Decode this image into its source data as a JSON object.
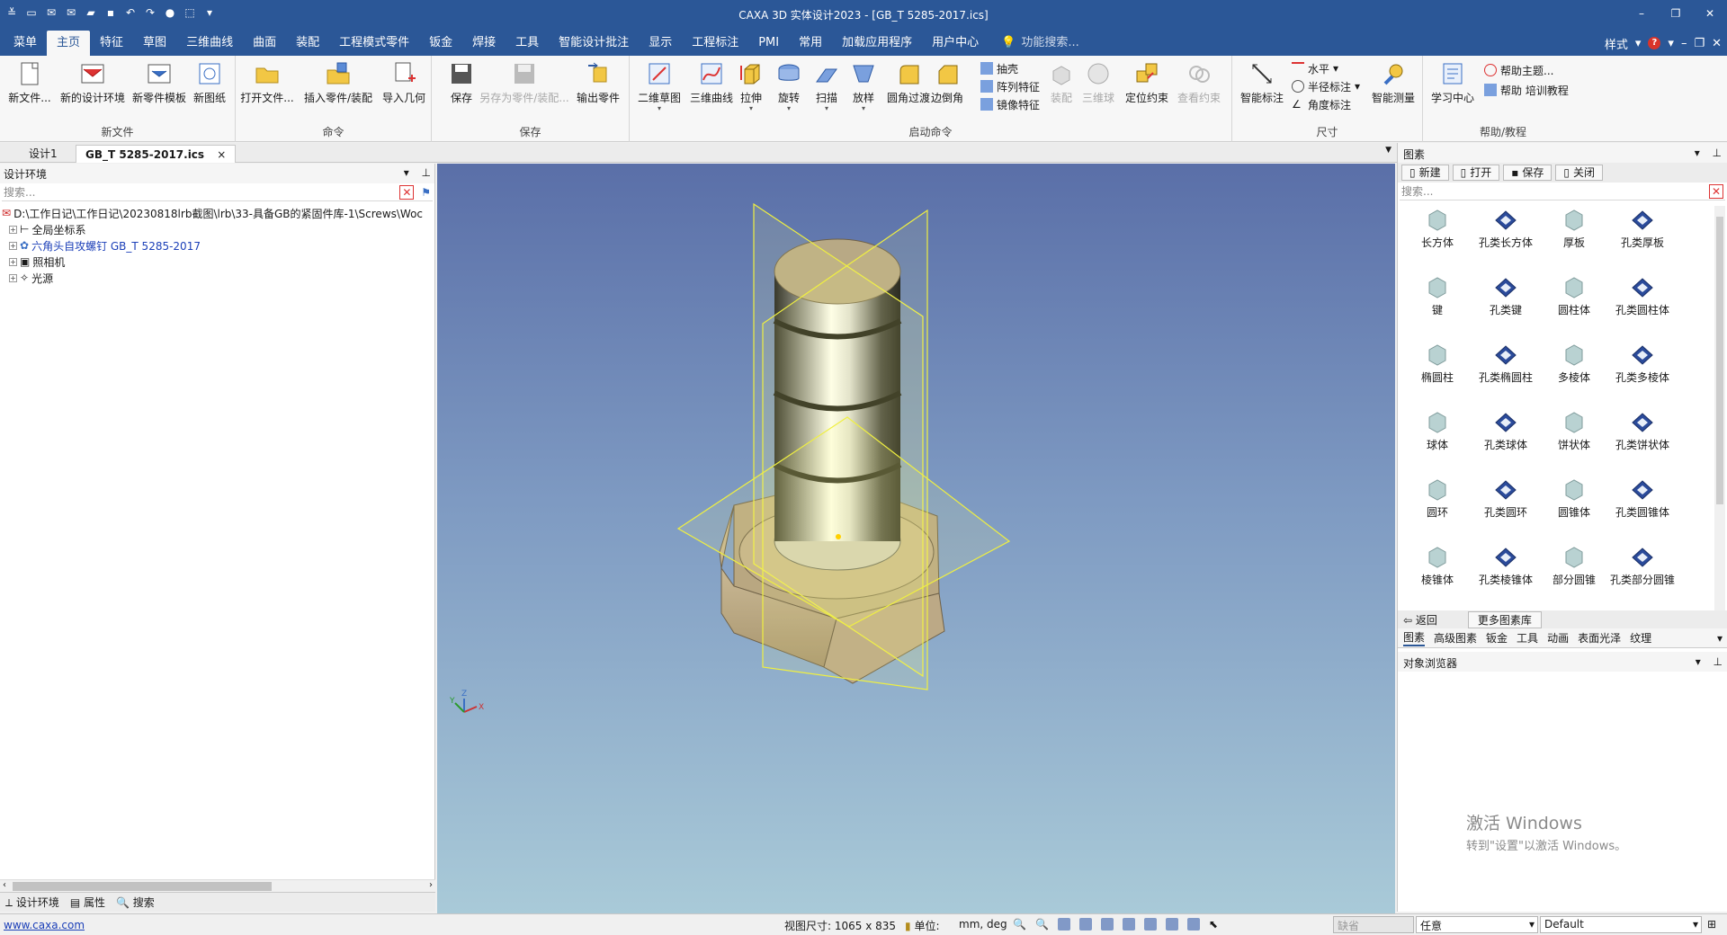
{
  "app": {
    "title": "CAXA 3D 实体设计2023 - [GB_T 5285-2017.ics]"
  },
  "menu": {
    "tabs": [
      "菜单",
      "主页",
      "特征",
      "草图",
      "三维曲线",
      "曲面",
      "装配",
      "工程模式零件",
      "钣金",
      "焊接",
      "工具",
      "智能设计批注",
      "显示",
      "工程标注",
      "PMI",
      "常用",
      "加载应用程序",
      "用户中心"
    ],
    "feature_search": "功能搜索...",
    "style_label": "样式",
    "help_icon_text": "?"
  },
  "ribbon": {
    "groups": {
      "new_file": "新文件",
      "command": "命令",
      "save": "保存",
      "launch": "启动命令",
      "dimension": "尺寸",
      "help": "帮助/教程"
    },
    "buttons": {
      "new_file": "新文件...",
      "new_env": "新的设计环境",
      "new_template": "新零件模板",
      "new_drawing": "新图纸",
      "open_file": "打开文件...",
      "insert_part": "插入零件/装配",
      "import_geom": "导入几何",
      "save": "保存",
      "save_as": "另存为零件/装配...",
      "export_part": "输出零件",
      "sketch2d": "二维草图",
      "curve3d": "三维曲线",
      "extrude": "拉伸",
      "revolve": "旋转",
      "sweep": "扫描",
      "loft": "放样",
      "fillet": "圆角过渡",
      "chamfer": "边倒角",
      "shell": "抽壳",
      "pattern": "阵列特征",
      "mirror": "镜像特征",
      "assemble": "装配",
      "ball3d": "三维球",
      "position_constraint": "定位约束",
      "view_constraint": "查看约束",
      "smart_dim": "智能标注",
      "horizontal": "水平",
      "radius_dim": "半径标注",
      "angle_dim": "角度标注",
      "smart_measure": "智能测量",
      "learning_center": "学习中心",
      "help_topics": "帮助主题...",
      "help_training": "帮助 培训教程"
    }
  },
  "doc_tabs": [
    "设计1",
    "GB_T 5285-2017.ics"
  ],
  "left_panel": {
    "title": "设计环境",
    "search_placeholder": "搜索...",
    "path": "D:\\工作日记\\工作日记\\20230818lrb截图\\lrb\\33-具备GB的紧固件库-1\\Screws\\Woc",
    "tree": [
      {
        "label": "全局坐标系",
        "link": false
      },
      {
        "label": "六角头自攻螺钉 GB_T 5285-2017",
        "link": true
      },
      {
        "label": "照相机",
        "link": false
      },
      {
        "label": "光源",
        "link": false
      }
    ],
    "bottom_tabs": [
      "设计环境",
      "属性",
      "搜索"
    ]
  },
  "right_panel": {
    "title": "图素",
    "buttons": [
      "新建",
      "打开",
      "保存",
      "关闭"
    ],
    "search_placeholder": "搜索...",
    "items": [
      "长方体",
      "孔类长方体",
      "厚板",
      "孔类厚板",
      "键",
      "孔类键",
      "圆柱体",
      "孔类圆柱体",
      "椭圆柱",
      "孔类椭圆柱",
      "多棱体",
      "孔类多棱体",
      "球体",
      "孔类球体",
      "饼状体",
      "孔类饼状体",
      "圆环",
      "孔类圆环",
      "圆锥体",
      "孔类圆锥体",
      "棱锥体",
      "孔类棱锥体",
      "部分圆锥",
      "孔类部分圆锥"
    ],
    "nav_back": "返回",
    "nav_more": "更多图素库",
    "tabs": [
      "图素",
      "高级图素",
      "钣金",
      "工具",
      "动画",
      "表面光泽",
      "纹理"
    ],
    "object_browser": "对象浏览器",
    "activate_line1": "激活 Windows",
    "activate_line2": "转到\"设置\"以激活 Windows。"
  },
  "status": {
    "link": "www.caxa.com",
    "view_size": "视图尺寸: 1065 x  835",
    "unit_label": "单位:",
    "unit_value": "mm, deg",
    "combo1": "缺省",
    "combo2": "任意",
    "combo3": "Default"
  },
  "viewport": {
    "axis_z": "Z",
    "axis_y": "Y",
    "axis_x": "X"
  }
}
